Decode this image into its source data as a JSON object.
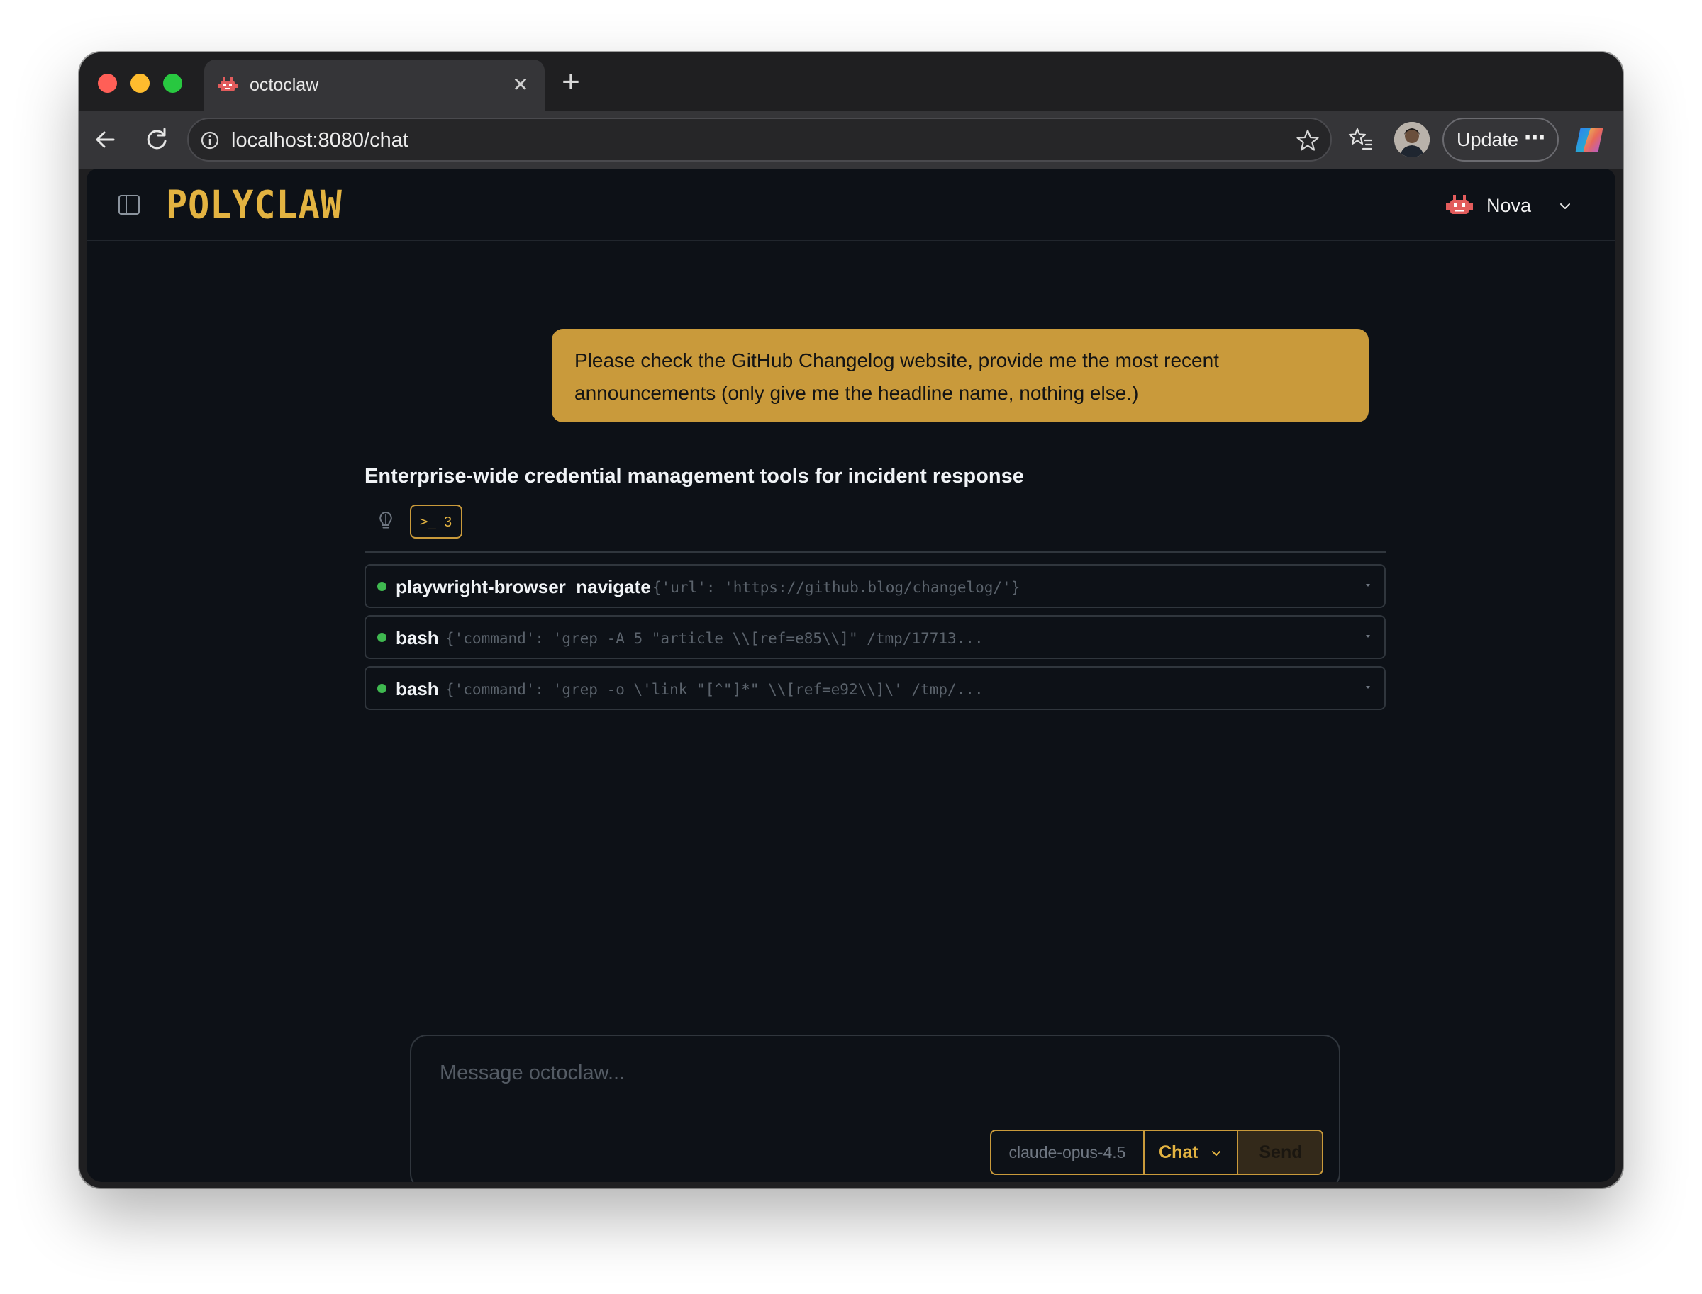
{
  "browser": {
    "tab_title": "octoclaw",
    "tab_close_icon": "close-icon",
    "new_tab_icon": "plus-icon",
    "url": "localhost:8080/chat",
    "update_label": "Update",
    "update_more": "⋯"
  },
  "app": {
    "logo": "POLYCLAW",
    "agent": {
      "name": "Nova",
      "icon": "robot-icon"
    }
  },
  "chat": {
    "user_message": "Please check the GitHub Changelog website, provide me the most recent announcements (only give me the headline name, nothing else.)",
    "reply_title": "Enterprise-wide credential management tools for incident response",
    "terminal_chip": {
      "glyph": ">_",
      "count": "3"
    },
    "tool_calls": [
      {
        "name": "playwright-browser_navigate",
        "args": "{'url': 'https://github.blog/changelog/'}",
        "status": "success"
      },
      {
        "name": "bash",
        "args": "{'command': 'grep -A 5 \"article \\\\[ref=e85\\\\]\" /tmp/17713...",
        "status": "success"
      },
      {
        "name": "bash",
        "args": "{'command': 'grep -o \\'link \"[^\"]*\" \\\\[ref=e92\\\\]\\' /tmp/...",
        "status": "success"
      }
    ]
  },
  "composer": {
    "placeholder": "Message octoclaw...",
    "model": "claude-opus-4.5",
    "mode": "Chat",
    "send_label": "Send"
  },
  "colors": {
    "accent": "#c99a3b",
    "logo": "#e3b341",
    "background": "#0d1117",
    "status_success": "#3fb950"
  }
}
